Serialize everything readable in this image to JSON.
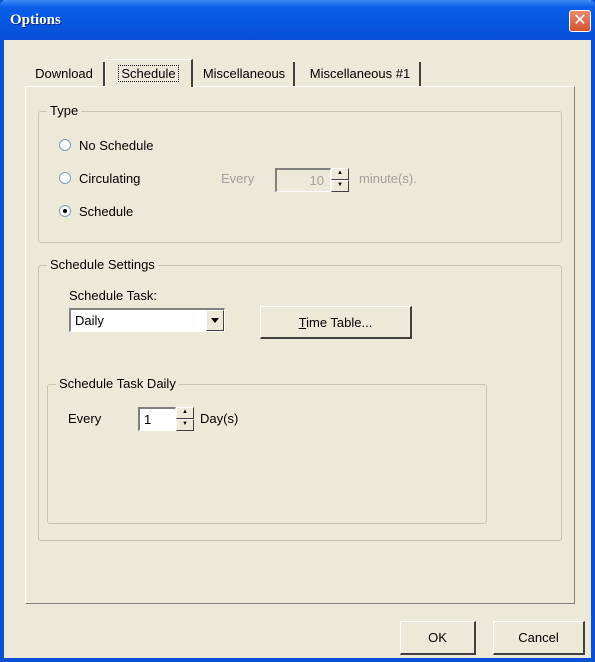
{
  "window": {
    "title": "Options",
    "close_symbol": "✕"
  },
  "tabs": [
    {
      "label": "Download",
      "selected": false
    },
    {
      "label": "Schedule",
      "selected": true
    },
    {
      "label": "Miscellaneous",
      "selected": false
    },
    {
      "label": "Miscellaneous #1",
      "selected": false
    }
  ],
  "type_group": {
    "label": "Type",
    "options": [
      {
        "label": "No Schedule",
        "selected": false
      },
      {
        "label": "Circulating",
        "selected": false
      },
      {
        "label": "Schedule",
        "selected": true
      }
    ],
    "circulating": {
      "every_label": "Every",
      "value": "10",
      "unit": "minute(s).",
      "enabled": false
    }
  },
  "schedule_settings": {
    "label": "Schedule Settings",
    "task_label": "Schedule Task:",
    "task_value": "Daily",
    "time_table_prefix": "",
    "time_table_mnemonic": "T",
    "time_table_rest": "ime Table...",
    "daily": {
      "label": "Schedule Task Daily",
      "every_label": "Every",
      "value": "1",
      "unit": "Day(s)"
    }
  },
  "footer": {
    "ok_label": "OK",
    "cancel_label": "Cancel"
  },
  "icons": {
    "spin_up": "up-arrow-icon",
    "spin_down": "down-arrow-icon",
    "dropdown": "chevron-down-icon"
  }
}
